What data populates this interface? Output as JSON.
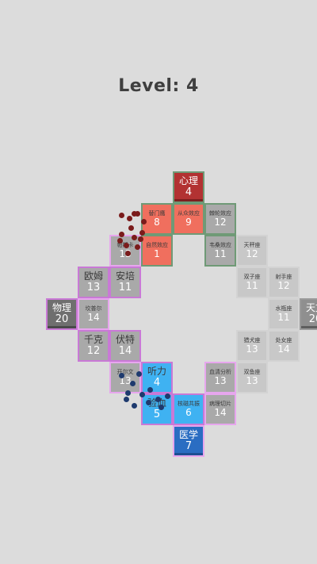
{
  "header": {
    "level_label": "Level:",
    "level_value": "4"
  },
  "colors": {
    "background": "#dcdcdc",
    "dark_red": "#b23232",
    "salmon": "#f06f5e",
    "green_frame": "#6f9a76",
    "gray_tile": "#a9a9a9",
    "light_gray": "#c8c8c8",
    "dark_gray": "#6f6f6f",
    "mid_gray": "#8f8f8f",
    "sky_blue": "#3fb2f2",
    "blue": "#2a6dc2",
    "pink_frame": "#e7a6ee",
    "magenta_frame": "#c979d6"
  },
  "tiles": [
    {
      "id": "xinli",
      "label": "心理",
      "value": "4",
      "style": "dark-red",
      "size": "big",
      "col": 5,
      "row": 0
    },
    {
      "id": "tidaoshuang",
      "label": "替门鹰",
      "value": "8",
      "style": "salmon",
      "size": "small",
      "col": 4,
      "row": 1
    },
    {
      "id": "congzhong",
      "label": "从众效应",
      "value": "9",
      "style": "salmon",
      "size": "small",
      "col": 5,
      "row": 1
    },
    {
      "id": "chilun",
      "label": "棘轮效应",
      "value": "12",
      "style": "gray-green",
      "size": "small",
      "col": 6,
      "row": 1
    },
    {
      "id": "pasika",
      "label": "帕斯卡",
      "value": "13",
      "style": "gray-purple",
      "size": "small",
      "col": 3,
      "row": 2
    },
    {
      "id": "baiziying",
      "label": "自然效应",
      "value": "1",
      "style": "salmon",
      "size": "small",
      "col": 4,
      "row": 2
    },
    {
      "id": "weisang",
      "label": "韦桑效应",
      "value": "11",
      "style": "gray-green",
      "size": "small",
      "col": 6,
      "row": 2
    },
    {
      "id": "tiancheng",
      "label": "天秤座",
      "value": "12",
      "style": "light-gray",
      "size": "small",
      "col": 7,
      "row": 2
    },
    {
      "id": "oumu",
      "label": "欧姆",
      "value": "13",
      "style": "gray-purple-dark",
      "size": "big",
      "col": 2,
      "row": 3
    },
    {
      "id": "anpei",
      "label": "安培",
      "value": "11",
      "style": "gray-purple-dark",
      "size": "big",
      "col": 3,
      "row": 3
    },
    {
      "id": "shuangzi",
      "label": "双子座",
      "value": "11",
      "style": "light-gray",
      "size": "small",
      "col": 7,
      "row": 3
    },
    {
      "id": "sheshou",
      "label": "射手座",
      "value": "12",
      "style": "light-gray",
      "size": "small",
      "col": 8,
      "row": 3
    },
    {
      "id": "wuli",
      "label": "物理",
      "value": "20",
      "style": "dark-gray",
      "size": "big",
      "col": 1,
      "row": 4
    },
    {
      "id": "kapule",
      "label": "坎普尔",
      "value": "14",
      "style": "gray-purple",
      "size": "small",
      "col": 2,
      "row": 4
    },
    {
      "id": "shuiping",
      "label": "水瓶座",
      "value": "11",
      "style": "light-gray",
      "size": "small",
      "col": 8,
      "row": 4
    },
    {
      "id": "tianwen",
      "label": "天文",
      "value": "20",
      "style": "mid-gray",
      "size": "big",
      "col": 9,
      "row": 4
    },
    {
      "id": "qianke",
      "label": "千克",
      "value": "12",
      "style": "gray-purple-dark",
      "size": "big",
      "col": 2,
      "row": 5
    },
    {
      "id": "fute",
      "label": "伏特",
      "value": "14",
      "style": "gray-purple-dark",
      "size": "big",
      "col": 3,
      "row": 5
    },
    {
      "id": "liequan",
      "label": "猎犬座",
      "value": "13",
      "style": "light-gray",
      "size": "small",
      "col": 7,
      "row": 5
    },
    {
      "id": "chunv",
      "label": "处女座",
      "value": "14",
      "style": "light-gray",
      "size": "small",
      "col": 8,
      "row": 5
    },
    {
      "id": "kaierwen",
      "label": "开尔文",
      "value": "13",
      "style": "gray-purple",
      "size": "small",
      "col": 3,
      "row": 6
    },
    {
      "id": "tingli",
      "label": "听力",
      "value": "4",
      "style": "sky-blue",
      "size": "big",
      "col": 4,
      "row": 6
    },
    {
      "id": "xueqing",
      "label": "血清分析",
      "value": "13",
      "style": "gray-pink",
      "size": "small",
      "col": 6,
      "row": 6
    },
    {
      "id": "shuangyu",
      "label": "双鱼座",
      "value": "13",
      "style": "light-gray",
      "size": "small",
      "col": 7,
      "row": 6
    },
    {
      "id": "yanxue",
      "label": "验血",
      "value": "5",
      "style": "sky-blue",
      "size": "big",
      "col": 4,
      "row": 7
    },
    {
      "id": "hecigong",
      "label": "核磁共振",
      "value": "6",
      "style": "sky-blue",
      "size": "small",
      "col": 5,
      "row": 7
    },
    {
      "id": "bingli",
      "label": "病理切片",
      "value": "14",
      "style": "gray-pink",
      "size": "small",
      "col": 6,
      "row": 7
    },
    {
      "id": "yixue",
      "label": "医学",
      "value": "7",
      "style": "blue",
      "size": "big",
      "col": 5,
      "row": 8
    }
  ]
}
